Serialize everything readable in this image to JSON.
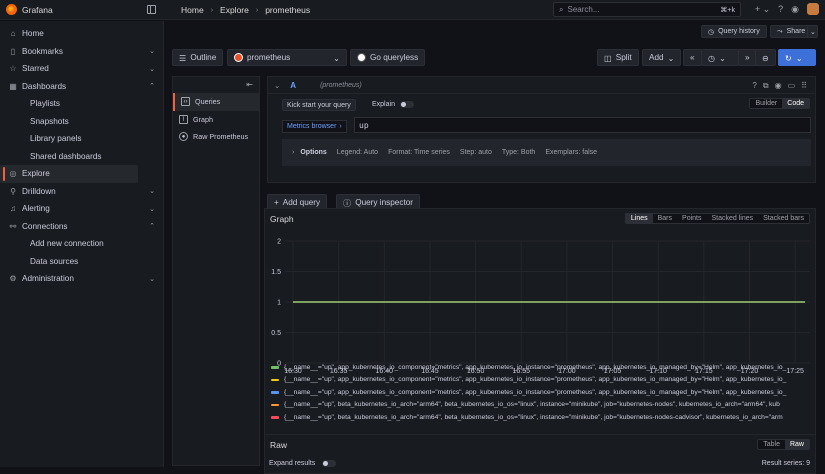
{
  "app": {
    "name": "Grafana"
  },
  "breadcrumbs": [
    "Home",
    "Explore",
    "prometheus"
  ],
  "search": {
    "placeholder": "Search...",
    "shortcut": "⌘+k"
  },
  "nav": {
    "items": [
      {
        "label": "Home",
        "icon": "home-icon"
      },
      {
        "label": "Bookmarks",
        "icon": "bookmark-icon"
      },
      {
        "label": "Starred",
        "icon": "star-icon"
      },
      {
        "label": "Dashboards",
        "icon": "apps-icon"
      },
      {
        "label": "Playlists"
      },
      {
        "label": "Snapshots"
      },
      {
        "label": "Library panels"
      },
      {
        "label": "Shared dashboards"
      },
      {
        "label": "Explore",
        "icon": "compass-icon"
      },
      {
        "label": "Drilldown",
        "icon": "drilldown-icon"
      },
      {
        "label": "Alerting",
        "icon": "bell-icon"
      },
      {
        "label": "Connections",
        "icon": "plug-icon"
      },
      {
        "label": "Add new connection"
      },
      {
        "label": "Data sources"
      },
      {
        "label": "Administration",
        "icon": "cog-icon"
      }
    ]
  },
  "explore": {
    "query_history": "Query history",
    "share": "Share",
    "outline": "Outline",
    "datasource": "prometheus",
    "go_queryless": "Go queryless",
    "split": "Split",
    "add": "Add"
  },
  "outline_items": [
    "Queries",
    "Graph",
    "Raw Prometheus"
  ],
  "query": {
    "name": "A",
    "datasource": "(prometheus)",
    "kick_start": "Kick start your query",
    "explain": "Explain",
    "builder": "Builder",
    "code": "Code",
    "metrics_browser": "Metrics browser",
    "expr": "up",
    "options_label": "Options",
    "options": [
      "Legend: Auto",
      "Format: Time series",
      "Step: auto",
      "Type: Both",
      "Exemplars: false"
    ],
    "add_query": "Add query",
    "query_inspector": "Query inspector"
  },
  "graph": {
    "title": "Graph",
    "view_modes": [
      "Lines",
      "Bars",
      "Points",
      "Stacked lines",
      "Stacked bars"
    ],
    "active_mode": "Lines"
  },
  "chart_data": {
    "type": "line",
    "x": [
      "16:30",
      "16:35",
      "16:40",
      "16:45",
      "16:50",
      "16:55",
      "17:00",
      "17:05",
      "17:10",
      "17:15",
      "17:20",
      "17:25"
    ],
    "yticks": [
      "0",
      "0.5",
      "1",
      "1.5",
      "2"
    ],
    "ylim": [
      0,
      2
    ],
    "grid": true,
    "series": [
      {
        "name": "{__name__=\"up\", app_kubernetes_io_component=\"metrics\", app_kubernetes_io_instance=\"prometheus\", app_kubernetes_io_managed_by=\"Helm\", app_kubernetes_io_",
        "color": "#73bf69",
        "value": 1
      },
      {
        "name": "{__name__=\"up\", app_kubernetes_io_component=\"metrics\", app_kubernetes_io_instance=\"prometheus\", app_kubernetes_io_managed_by=\"Helm\", app_kubernetes_io_",
        "color": "#f2cc0c",
        "value": 1
      },
      {
        "name": "{__name__=\"up\", app_kubernetes_io_component=\"metrics\", app_kubernetes_io_instance=\"prometheus\", app_kubernetes_io_managed_by=\"Helm\", app_kubernetes_io_",
        "color": "#5794f2",
        "value": 1
      },
      {
        "name": "{__name__=\"up\", beta_kubernetes_io_arch=\"arm64\", beta_kubernetes_io_os=\"linux\", instance=\"minikube\", job=\"kubernetes-nodes\", kubernetes_io_arch=\"arm64\", kub",
        "color": "#ff9830",
        "value": 1
      },
      {
        "name": "{__name__=\"up\", beta_kubernetes_io_arch=\"arm64\", beta_kubernetes_io_os=\"linux\", instance=\"minikube\", job=\"kubernetes-nodes-cadvisor\", kubernetes_io_arch=\"arm",
        "color": "#f2495c",
        "value": 1
      }
    ]
  },
  "raw": {
    "title": "Raw",
    "modes": [
      "Table",
      "Raw"
    ],
    "active_mode": "Raw",
    "expand_results": "Expand results",
    "result_series": "Result series: 9"
  }
}
